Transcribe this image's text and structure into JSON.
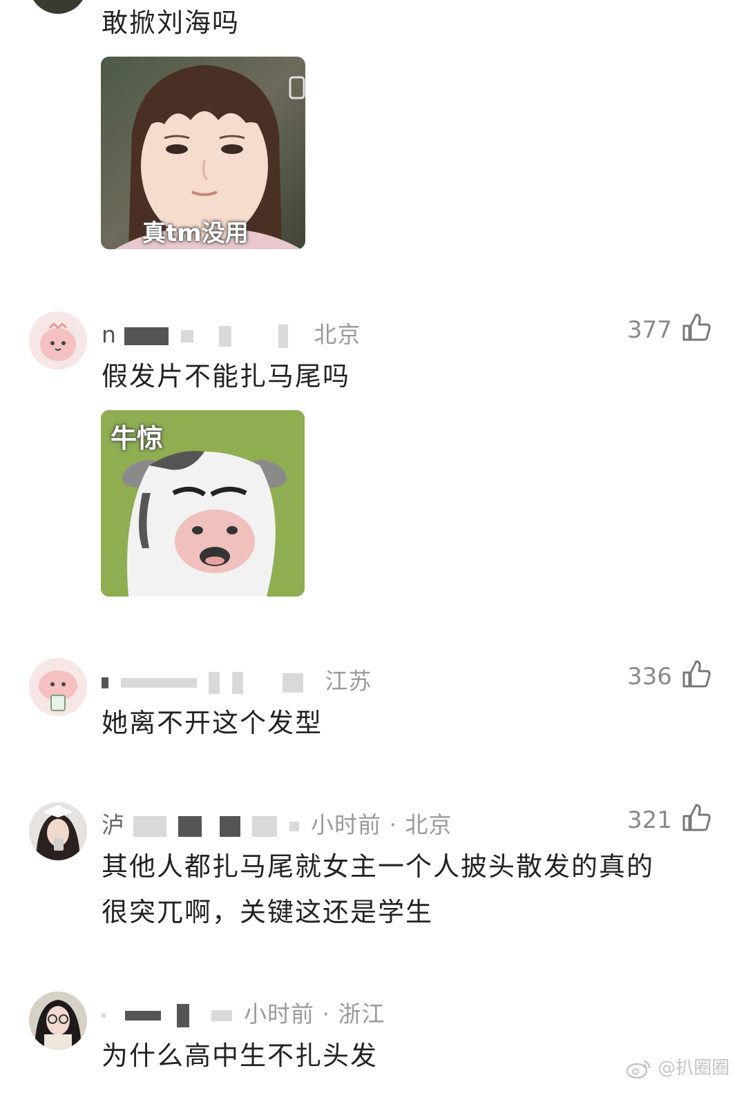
{
  "comments": [
    {
      "text": "敢掀刘海吗",
      "sticker_caption": "真tm没用"
    },
    {
      "username_visible": "n",
      "location": "北京",
      "likes": "377",
      "text": "假发片不能扎马尾吗",
      "sticker_caption": "牛惊"
    },
    {
      "location": "江苏",
      "likes": "336",
      "text": "她离不开这个发型"
    },
    {
      "username_visible": "泸",
      "time_location": "小时前 · 北京",
      "likes": "321",
      "text_line1": "其他人都扎马尾就女主一个人披头散发的真的",
      "text_line2": "很突兀啊，关键这还是学生"
    },
    {
      "time_location": "小时前 · 浙江",
      "text": "为什么高中生不扎头发"
    }
  ],
  "watermark": "@扒圈圈",
  "colors": {
    "meta": "#9a9a9a",
    "text": "#222222",
    "cow_bg": "#8fae52",
    "avatar_pink": "#f4d3d3"
  },
  "icons": [
    "thumbs-up-icon",
    "weibo-logo-icon",
    "iqiyi-logo-icon"
  ]
}
